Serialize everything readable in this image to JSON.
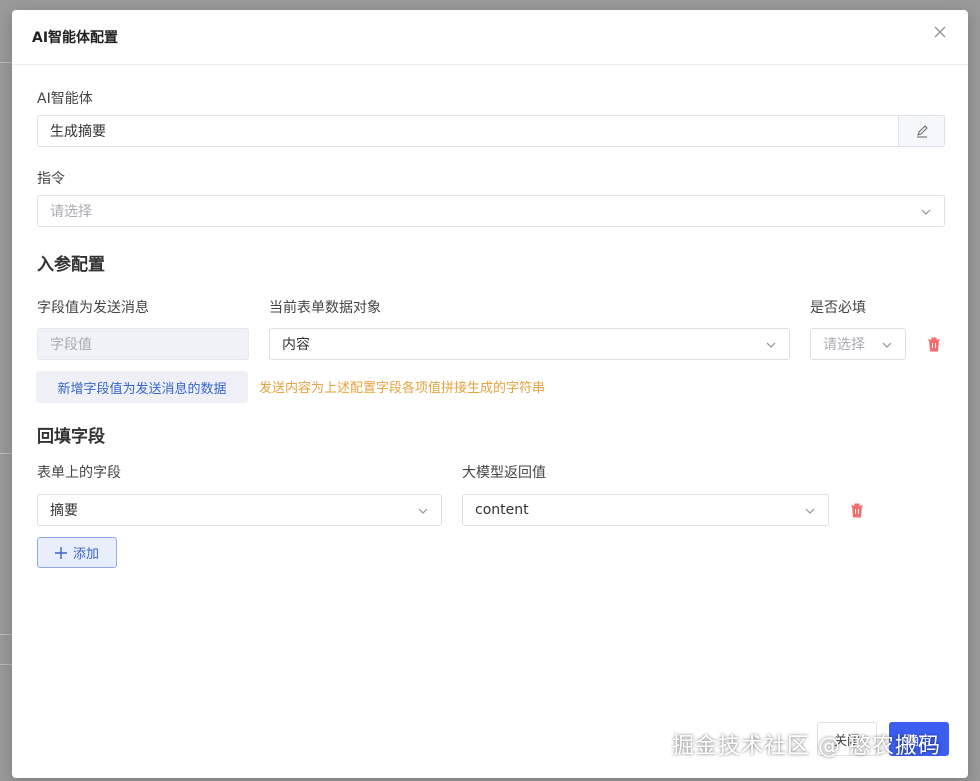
{
  "modal": {
    "title": "AI智能体配置"
  },
  "agent": {
    "label": "AI智能体",
    "value": "生成摘要"
  },
  "command": {
    "label": "指令",
    "placeholder": "请选择"
  },
  "input_config": {
    "title": "入参配置",
    "col_field_value": "字段值为发送消息",
    "col_form_object": "当前表单数据对象",
    "col_required": "是否必填",
    "row": {
      "field_value_placeholder": "字段值",
      "form_object_value": "内容",
      "required_placeholder": "请选择"
    },
    "add_button_label": "新增字段值为发送消息的数据",
    "hint": "发送内容为上述配置字段各项值拼接生成的字符串"
  },
  "backfill": {
    "title": "回填字段",
    "col_form_field": "表单上的字段",
    "col_model_return": "大模型返回值",
    "row": {
      "form_field_value": "摘要",
      "model_return_value": "content"
    },
    "add_button_label": "添加"
  },
  "footer": {
    "cancel_label": "关闭",
    "ok_label": "确定"
  },
  "watermark": "掘金技术社区 @ 憨农搬码",
  "colors": {
    "primary": "#3b5ef0",
    "danger": "#f56c6c",
    "warning": "#e6a23c",
    "link": "#3366cc"
  }
}
